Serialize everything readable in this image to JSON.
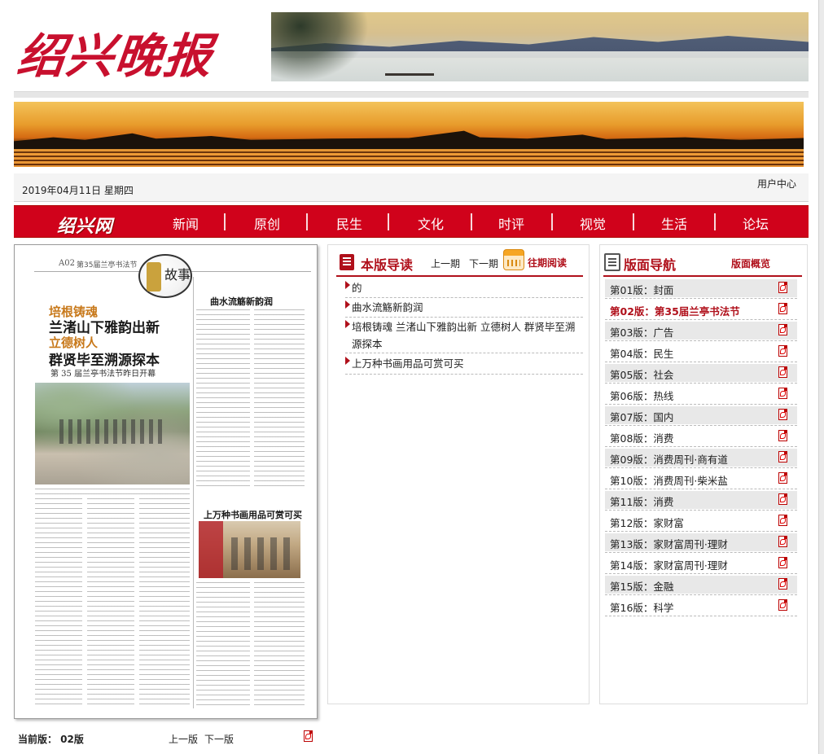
{
  "site": {
    "logo_text": "绍兴晚报",
    "nav_logo": "绍兴网",
    "date": "2019年04月11日 星期四",
    "user_center": "用户中心"
  },
  "nav": [
    "新闻",
    "原创",
    "民生",
    "文化",
    "时评",
    "视觉",
    "生活",
    "论坛"
  ],
  "paper_preview": {
    "page_no": "A02",
    "section": "第35届兰亭书法节",
    "headline_tag1": "培根铸魂",
    "headline_line1": "兰渚山下雅韵出新",
    "headline_tag2": "立德树人",
    "headline_line2": "群贤毕至溯源探本",
    "headline_sub": "第 35 届兰亭书法节昨日开幕",
    "story2_title": "曲水流觞新韵润",
    "story3_title": "上万种书画用品可赏可买",
    "circle_char": "故事"
  },
  "bottom_bar": {
    "current_label": "当前版：  02版",
    "prev": "上一版",
    "next": "下一版"
  },
  "guide": {
    "title": "本版导读",
    "prev": "上一期",
    "next": "下一期",
    "past": "往期阅读",
    "articles": [
      "的",
      "曲水流觞新韵润",
      "培根铸魂 兰渚山下雅韵出新 立德树人 群贤毕至溯源探本",
      "上万种书画用品可赏可买"
    ]
  },
  "page_nav": {
    "title": "版面导航",
    "overview": "版面概览",
    "active_index": 1,
    "pages": [
      "第01版：封面",
      "第02版：第35届兰亭书法节",
      "第03版：广告",
      "第04版：民生",
      "第05版：社会",
      "第06版：热线",
      "第07版：国内",
      "第08版：消费",
      "第09版：消费周刊·商有道",
      "第10版：消费周刊·柴米盐",
      "第11版：消费",
      "第12版：家财富",
      "第13版：家财富周刊·理财",
      "第14版：家财富周刊·理财",
      "第15版：金融",
      "第16版：科学"
    ]
  },
  "colors": {
    "brand_red": "#d0021b",
    "title_red": "#b0101b"
  },
  "icons": [
    "pdf-icon",
    "calendar-icon",
    "list-icon",
    "arrow-bullet-icon"
  ]
}
